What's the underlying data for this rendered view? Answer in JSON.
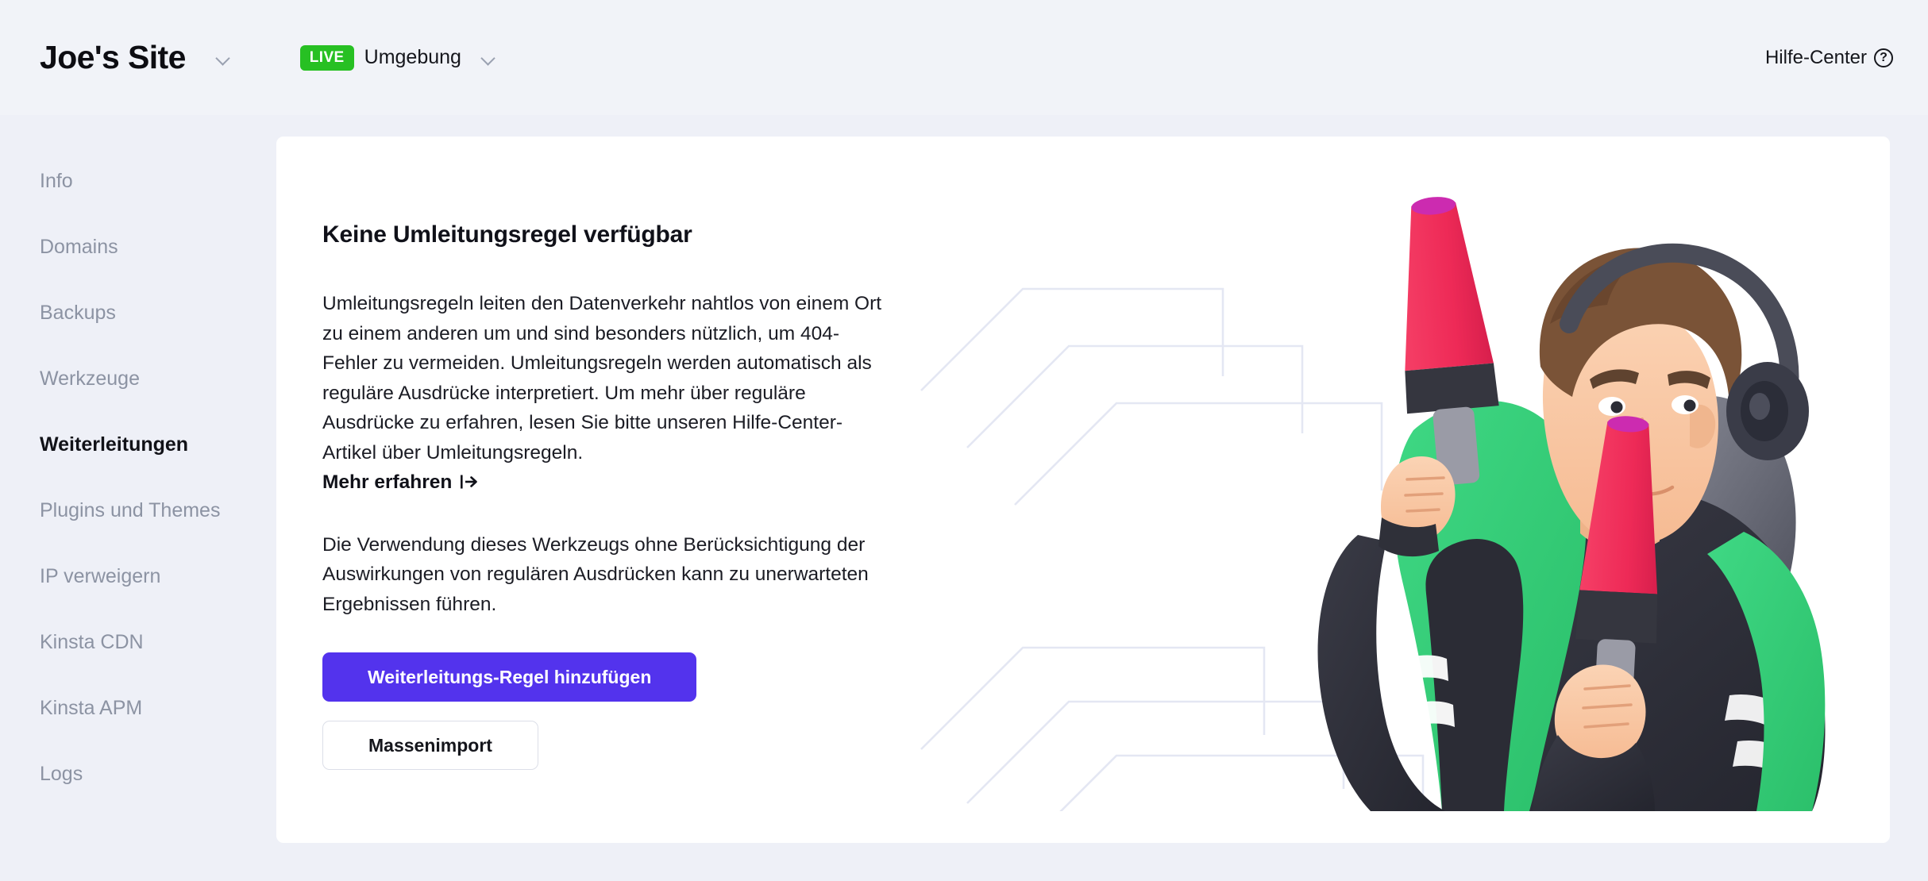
{
  "header": {
    "site_name": "Joe's Site",
    "site_dropdown_icon": "chevron-down-icon",
    "live_badge": "LIVE",
    "environment_label": "Umgebung",
    "environment_dropdown_icon": "chevron-down-icon",
    "help_center_label": "Hilfe-Center",
    "help_center_icon": "question-circle-icon"
  },
  "sidebar": {
    "items": [
      {
        "label": "Info",
        "active": false
      },
      {
        "label": "Domains",
        "active": false
      },
      {
        "label": "Backups",
        "active": false
      },
      {
        "label": "Werkzeuge",
        "active": false
      },
      {
        "label": "Weiterleitungen",
        "active": true
      },
      {
        "label": "Plugins und Themes",
        "active": false
      },
      {
        "label": "IP verweigern",
        "active": false
      },
      {
        "label": "Kinsta CDN",
        "active": false
      },
      {
        "label": "Kinsta APM",
        "active": false
      },
      {
        "label": "Logs",
        "active": false
      }
    ]
  },
  "main": {
    "title": "Keine Umleitungsregel verfügbar",
    "paragraph_1": "Umleitungsregeln leiten den Datenverkehr nahtlos von einem Ort zu einem anderen um und sind besonders nützlich, um 404-Fehler zu vermeiden. Umleitungsregeln werden automatisch als reguläre Ausdrücke interpretiert. Um mehr über reguläre Ausdrücke zu erfahren, lesen Sie bitte unseren Hilfe-Center-Artikel über Umleitungsregeln.",
    "learn_more_label": "Mehr erfahren",
    "learn_more_icon": "external-link-arrow-icon",
    "paragraph_2": "Die Verwendung dieses Werkzeugs ohne Berücksichtigung der Auswirkungen von regulären Ausdrücken kann zu unerwarteten Ergebnissen führen.",
    "primary_button": "Weiterleitungs-Regel hinzufügen",
    "secondary_button": "Massenimport",
    "illustration_name": "person-with-headphones-holding-signal-batons-illustration"
  },
  "colors": {
    "page_background": "#eef0f7",
    "header_background": "#f1f3f8",
    "card_background": "#ffffff",
    "primary_button": "#5333ed",
    "live_badge_green": "#27c023",
    "muted_text": "#8c93a3",
    "body_text": "#1b1c24",
    "illustration_green": "#35cd77",
    "illustration_pink": "#f2325e",
    "illustration_magenta": "#cc2bb0",
    "illustration_dark": "#2f3039",
    "illustration_skin": "#f9c7a3",
    "illustration_hair": "#7a5337"
  }
}
